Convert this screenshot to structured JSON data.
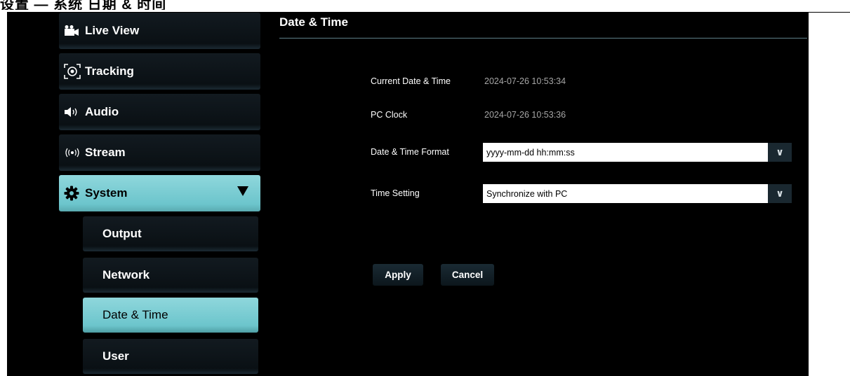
{
  "doc_header": "设置 — 系统 日期 & 时间",
  "sidebar": {
    "items": [
      {
        "label": "Live View",
        "icon": "video-camera-icon"
      },
      {
        "label": "Tracking",
        "icon": "tracking-target-icon"
      },
      {
        "label": "Audio",
        "icon": "speaker-icon"
      },
      {
        "label": "Stream",
        "icon": "broadcast-icon"
      },
      {
        "label": "System",
        "icon": "gear-icon",
        "expanded": true
      }
    ],
    "system_sub": [
      {
        "label": "Output"
      },
      {
        "label": "Network"
      },
      {
        "label": "Date & Time",
        "active": true
      },
      {
        "label": "User"
      }
    ]
  },
  "main": {
    "title": "Date & Time",
    "fields": {
      "current_label": "Current Date & Time",
      "current_value": "2024-07-26 10:53:34",
      "pc_clock_label": "PC Clock",
      "pc_clock_value": "2024-07-26 10:53:36",
      "format_label": "Date & Time Format",
      "format_value": "yyyy-mm-dd hh:mm:ss",
      "time_setting_label": "Time Setting",
      "time_setting_value": "Synchronize with PC"
    },
    "buttons": {
      "apply": "Apply",
      "cancel": "Cancel"
    }
  },
  "colors": {
    "accent": "#6cc5cc",
    "background": "#000000",
    "value_gray": "#a7a7a7"
  }
}
